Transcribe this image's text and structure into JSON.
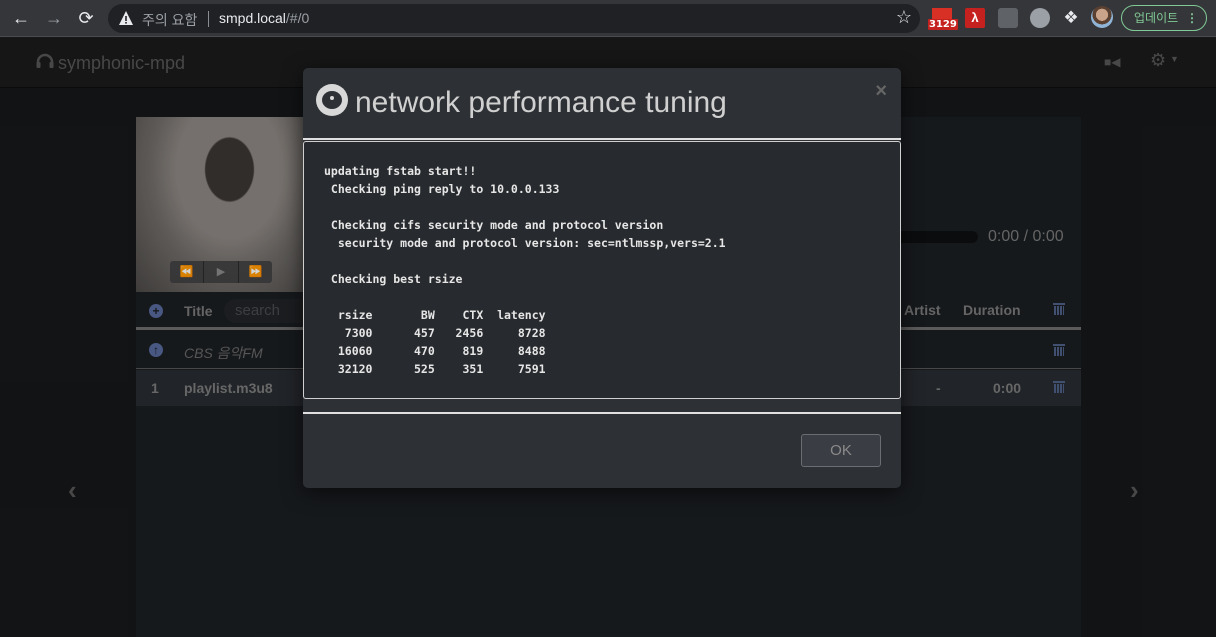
{
  "browser": {
    "back_icon": "arrow-left-icon",
    "forward_icon": "arrow-right-icon",
    "reload_icon": "reload-icon",
    "security_warning": "주의 요함",
    "url_host": "smpd.local",
    "url_path": "/#/0",
    "gmail_badge": "3129",
    "update_label": "업데이트",
    "menu_dots": "⋮"
  },
  "app": {
    "brand": "symphonic-mpd",
    "time": "0:00 / 0:00",
    "search_placeholder": "search",
    "columns": {
      "title": "Title",
      "artist": "Artist",
      "duration": "Duration"
    },
    "current_stream": "CBS 음악FM",
    "playlist": [
      {
        "index": "1",
        "title": "playlist.m3u8",
        "artist": "-",
        "duration": "0:00"
      }
    ]
  },
  "modal": {
    "title": "network performance tuning",
    "log_lines": [
      "updating fstab start!!",
      " Checking ping reply to 10.0.0.133",
      "",
      " Checking cifs security mode and protocol version",
      "  security mode and protocol version: sec=ntlmssp,vers=2.1",
      "",
      " Checking best rsize",
      "",
      "  rsize       BW    CTX  latency",
      "   7300      457   2456     8728",
      "  16060      470    819     8488",
      "  32120      525    351     7591"
    ],
    "rsize_table": {
      "headers": [
        "rsize",
        "BW",
        "CTX",
        "latency"
      ],
      "rows": [
        [
          "7300",
          "457",
          "2456",
          "8728"
        ],
        [
          "16060",
          "470",
          "819",
          "8488"
        ],
        [
          "32120",
          "525",
          "351",
          "7591"
        ]
      ]
    },
    "ok_label": "OK",
    "close_label": "×"
  }
}
